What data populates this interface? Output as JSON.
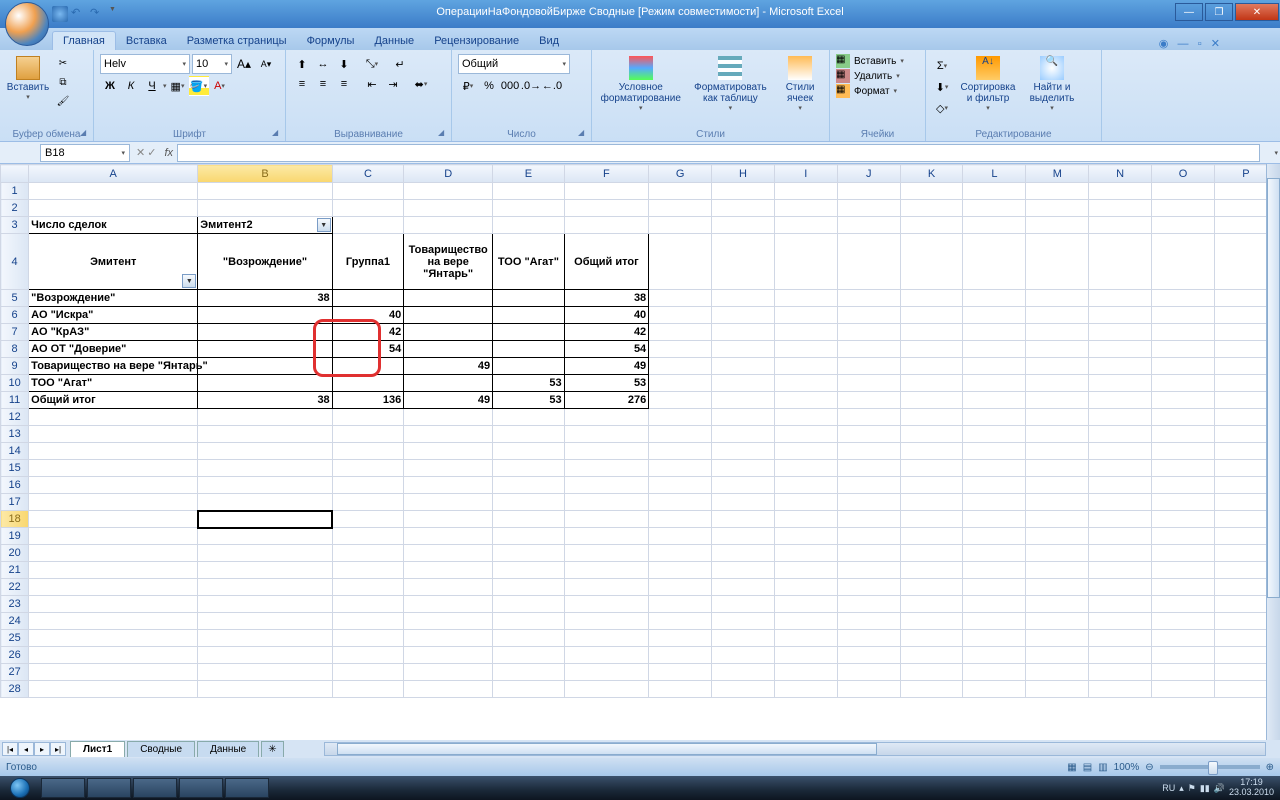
{
  "title": "ОперацииНаФондовойБирже  Сводные  [Режим совместимости] - Microsoft Excel",
  "tabs": {
    "home": "Главная",
    "insert": "Вставка",
    "page_layout": "Разметка страницы",
    "formulas": "Формулы",
    "data": "Данные",
    "review": "Рецензирование",
    "view": "Вид"
  },
  "ribbon": {
    "clipboard": {
      "label": "Буфер обмена",
      "paste": "Вставить"
    },
    "font": {
      "label": "Шрифт",
      "name": "Helv",
      "size": "10",
      "bold": "Ж",
      "italic": "К",
      "underline": "Ч"
    },
    "alignment": {
      "label": "Выравнивание"
    },
    "number": {
      "label": "Число",
      "format": "Общий"
    },
    "styles": {
      "label": "Стили",
      "conditional": "Условное форматирование",
      "as_table": "Форматировать как таблицу",
      "cell_styles": "Стили ячеек"
    },
    "cells": {
      "label": "Ячейки",
      "insert": "Вставить",
      "delete": "Удалить",
      "format": "Формат"
    },
    "editing": {
      "label": "Редактирование",
      "sort": "Сортировка и фильтр",
      "find": "Найти и выделить"
    }
  },
  "name_box": "B18",
  "pivot": {
    "measure": "Число сделок",
    "filter_field": "Эмитент2",
    "row_field": "Эмитент",
    "col_headers": [
      "\"Возрождение\"",
      "Группа1",
      "Товарищество на вере \"Янтарь\"",
      "ТОО \"Агат\"",
      "Общий итог"
    ],
    "rows": [
      {
        "label": "\"Возрождение\"",
        "v": [
          "38",
          "",
          "",
          "",
          "38"
        ]
      },
      {
        "label": "АО \"Искра\"",
        "v": [
          "",
          "40",
          "",
          "",
          "40"
        ]
      },
      {
        "label": "АО \"КрАЗ\"",
        "v": [
          "",
          "42",
          "",
          "",
          "42"
        ]
      },
      {
        "label": "АО ОТ \"Доверие\"",
        "v": [
          "",
          "54",
          "",
          "",
          "54"
        ]
      },
      {
        "label": "Товарищество на вере \"Янтарь\"",
        "v": [
          "",
          "",
          "49",
          "",
          "49"
        ]
      },
      {
        "label": "ТОО \"Агат\"",
        "v": [
          "",
          "",
          "",
          "53",
          "53"
        ]
      },
      {
        "label": "Общий итог",
        "v": [
          "38",
          "136",
          "49",
          "53",
          "276"
        ]
      }
    ]
  },
  "sheets": {
    "s1": "Лист1",
    "s2": "Сводные",
    "s3": "Данные"
  },
  "status": {
    "ready": "Готово",
    "zoom": "100%"
  },
  "tray": {
    "lang": "RU",
    "time": "17:19",
    "date": "23.03.2010"
  },
  "cols": [
    "A",
    "B",
    "C",
    "D",
    "E",
    "F",
    "G",
    "H",
    "I",
    "J",
    "K",
    "L",
    "M",
    "N",
    "O",
    "P"
  ]
}
